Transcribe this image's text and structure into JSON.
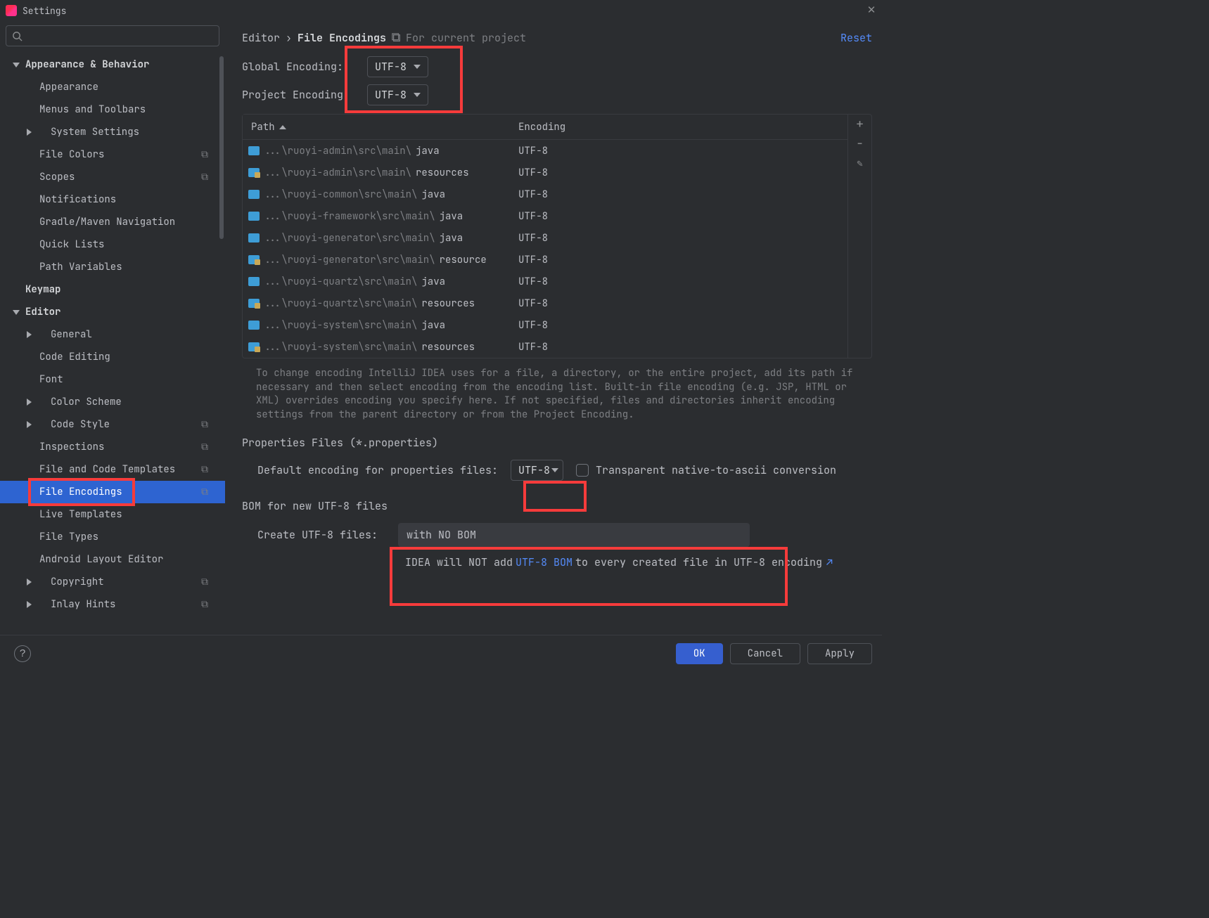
{
  "window_title": "Settings",
  "sidebar": {
    "items": [
      {
        "label": "Appearance & Behavior",
        "bold": true,
        "arrow": "down",
        "level": 0
      },
      {
        "label": "Appearance",
        "level": 1
      },
      {
        "label": "Menus and Toolbars",
        "level": 1
      },
      {
        "label": "System Settings",
        "level": 1,
        "arrow": "right"
      },
      {
        "label": "File Colors",
        "level": 1,
        "tag": "⧉"
      },
      {
        "label": "Scopes",
        "level": 1,
        "tag": "⧉"
      },
      {
        "label": "Notifications",
        "level": 1
      },
      {
        "label": "Gradle/Maven Navigation",
        "level": 1
      },
      {
        "label": "Quick Lists",
        "level": 1
      },
      {
        "label": "Path Variables",
        "level": 1
      },
      {
        "label": "Keymap",
        "bold": true,
        "level": 0,
        "noarrow": true
      },
      {
        "label": "Editor",
        "bold": true,
        "arrow": "down",
        "level": 0
      },
      {
        "label": "General",
        "level": 1,
        "arrow": "right"
      },
      {
        "label": "Code Editing",
        "level": 1
      },
      {
        "label": "Font",
        "level": 1
      },
      {
        "label": "Color Scheme",
        "level": 1,
        "arrow": "right"
      },
      {
        "label": "Code Style",
        "level": 1,
        "arrow": "right",
        "tag": "⧉"
      },
      {
        "label": "Inspections",
        "level": 1,
        "tag": "⧉"
      },
      {
        "label": "File and Code Templates",
        "level": 1,
        "tag": "⧉"
      },
      {
        "label": "File Encodings",
        "level": 1,
        "tag": "⧉",
        "selected": true
      },
      {
        "label": "Live Templates",
        "level": 1
      },
      {
        "label": "File Types",
        "level": 1
      },
      {
        "label": "Android Layout Editor",
        "level": 1
      },
      {
        "label": "Copyright",
        "level": 1,
        "arrow": "right",
        "tag": "⧉"
      },
      {
        "label": "Inlay Hints",
        "level": 1,
        "arrow": "right",
        "tag": "⧉"
      }
    ]
  },
  "breadcrumb": {
    "parent": "Editor",
    "sep": "›",
    "current": "File Encodings",
    "scope": "For current project",
    "reset": "Reset"
  },
  "form": {
    "global_encoding_label": "Global Encoding:",
    "global_encoding_value": "UTF-8",
    "project_encoding_label": "Project Encoding:",
    "project_encoding_value": "UTF-8"
  },
  "table": {
    "header_path": "Path",
    "header_encoding": "Encoding",
    "rows": [
      {
        "gray": "...\\ruoyi-admin\\src\\main\\",
        "name": "java",
        "enc": "UTF-8",
        "res": false
      },
      {
        "gray": "...\\ruoyi-admin\\src\\main\\",
        "name": "resources",
        "enc": "UTF-8",
        "res": true
      },
      {
        "gray": "...\\ruoyi-common\\src\\main\\",
        "name": "java",
        "enc": "UTF-8",
        "res": false
      },
      {
        "gray": "...\\ruoyi-framework\\src\\main\\",
        "name": "java",
        "enc": "UTF-8",
        "res": false
      },
      {
        "gray": "...\\ruoyi-generator\\src\\main\\",
        "name": "java",
        "enc": "UTF-8",
        "res": false
      },
      {
        "gray": "...\\ruoyi-generator\\src\\main\\",
        "name": "resource",
        "enc": "UTF-8",
        "res": true
      },
      {
        "gray": "...\\ruoyi-quartz\\src\\main\\",
        "name": "java",
        "enc": "UTF-8",
        "res": false
      },
      {
        "gray": "...\\ruoyi-quartz\\src\\main\\",
        "name": "resources",
        "enc": "UTF-8",
        "res": true
      },
      {
        "gray": "...\\ruoyi-system\\src\\main\\",
        "name": "java",
        "enc": "UTF-8",
        "res": false
      },
      {
        "gray": "...\\ruoyi-system\\src\\main\\",
        "name": "resources",
        "enc": "UTF-8",
        "res": true
      }
    ]
  },
  "help_text": "To change encoding IntelliJ IDEA uses for a file, a directory, or the entire project, add its path if necessary and then select encoding from the encoding list. Built-in file encoding (e.g. JSP, HTML or XML) overrides encoding you specify here. If not specified, files and directories inherit encoding settings from the parent directory or from the Project Encoding.",
  "properties": {
    "section": "Properties Files (*.properties)",
    "default_label": "Default encoding for properties files:",
    "default_value": "UTF-8",
    "checkbox_label": "Transparent native-to-ascii conversion"
  },
  "bom": {
    "section": "BOM for new UTF-8 files",
    "create_label": "Create UTF-8 files:",
    "create_value": "with NO BOM",
    "note_pre": "IDEA will NOT add ",
    "note_link": "UTF-8 BOM",
    "note_post": " to every created file in UTF-8 encoding"
  },
  "footer": {
    "ok": "OK",
    "cancel": "Cancel",
    "apply": "Apply"
  }
}
